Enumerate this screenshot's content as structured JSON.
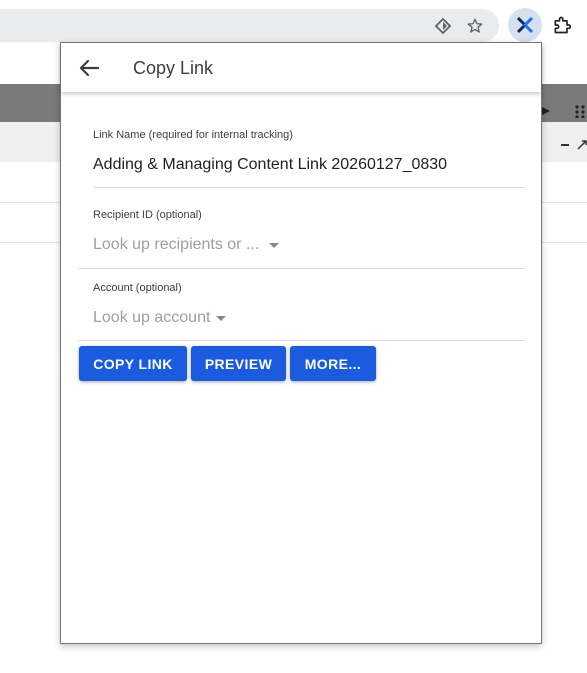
{
  "browser": {
    "icons": [
      "view-site-info-icon",
      "bookmark-star-icon",
      "active-extension-icon",
      "extensions-puzzle-icon"
    ]
  },
  "popup": {
    "title": "Copy Link",
    "fields": [
      {
        "label": "Link Name (required for internal tracking)",
        "value": "Adding & Managing Content Link 20260127_0830"
      },
      {
        "label": "Recipient ID (optional)",
        "placeholder": "Look up recipients or ..."
      },
      {
        "label": "Account (optional)",
        "placeholder": "Look up account"
      }
    ],
    "buttons": {
      "copy_link": "COPY LINK",
      "preview": "PREVIEW",
      "more": "MORE..."
    }
  },
  "colors": {
    "primary_button": "#1a5be0",
    "extension_accent": "#1a73e8"
  }
}
